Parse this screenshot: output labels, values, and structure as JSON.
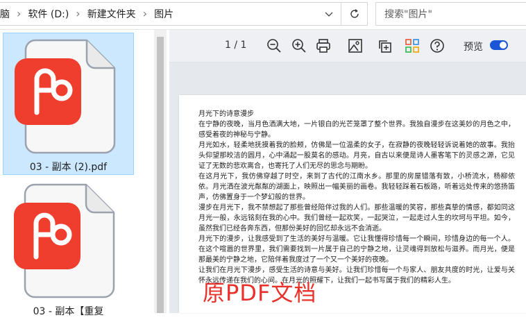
{
  "addressbar": {
    "breadcrumbs": [
      "脑",
      "软件 (D:)",
      "新建文件夹",
      "图片"
    ],
    "search_placeholder": "搜索\"图片\""
  },
  "files": [
    {
      "name": "03 - 副本 (2).pdf",
      "selected": true,
      "icon": "pdf-file-icon"
    },
    {
      "name": "03 - 副本【重复",
      "selected": false,
      "icon": "pdf-file-icon"
    }
  ],
  "preview": {
    "page_indicator": "1 / 1",
    "toggle_label": "预览",
    "toggle_on": true,
    "toolbar_icons": [
      "zoom-out-icon",
      "zoom-in-icon",
      "print-icon",
      "image-icon",
      "copy-icon",
      "apps-icon",
      "help-icon"
    ],
    "document": {
      "title": "月光下的诗意漫步",
      "paragraphs": [
        "在宁静的夜晚，当月色洒满大地，一片银白的光芒笼罩了整个世界。我独自漫步在这美妙的月色之中，感受着夜的神秘与宁静。",
        "月光如水，轻柔地抚摸着我的脸颊，仿佛是一位温柔的女子，在寂静的夜晚轻轻诉说着她的故事。我抬头仰望那皎洁的圆月，心中涌起一股莫名的感动。月亮，自古以来便是诗人墨客笔下的灵感之源，它见证了无数的悲欢离合，也寄托了人们无尽的思念与期盼。",
        "在这月光下，我仿佛穿越了时空，来到了古代的江南水乡。那里的房屋错落有致，小桥流水，杨柳依依。月光洒在波光粼粼的湖面上，映照出一幅美丽的画卷。我轻轻踩着石板路，听着远处传来的悠扬笛声，仿佛置身于一个梦幻般的世界。",
        "漫步在月光下，我不禁想起了那些曾经陪伴过我的人们。那些温暖的笑容，那些真挚的情感，都如同这月光一般，永远铭刻在我的心中。我们曾经一起欢笑，一起哭泣，一起走过人生的坎坷与平坦。如今，虽然我们已经各奔东西，但那份美好的回忆却永远不会消逝。",
        "月光下的漫步，让我感受到了生活的美好与温暖。它让我懂得珍惜每一个瞬间，珍惜身边的每一个人。在这个喧嚣的世界里，我们需要找到一片属于自己的宁静之地，让灵魂得到放松与滋养。而月光，便是那最美的宁静之地，它陪伴着我度过了一个又一个美好的夜晚。",
        "让我们在月光下漫步，感受生活的诗意与美好。让我们珍惜每一个与家人、朋友共度的时光，让爱与关怀永远传递在我们的心间。在月光的照耀下，让我们一起书写属于我们的精彩人生。"
      ],
      "overlay_label": "原PDF文档"
    }
  },
  "colors": {
    "selection_bg": "#cce8ff",
    "accent": "#1a56d6",
    "stamp": "#e8312a",
    "pdf_icon": "#ef3e2e"
  }
}
